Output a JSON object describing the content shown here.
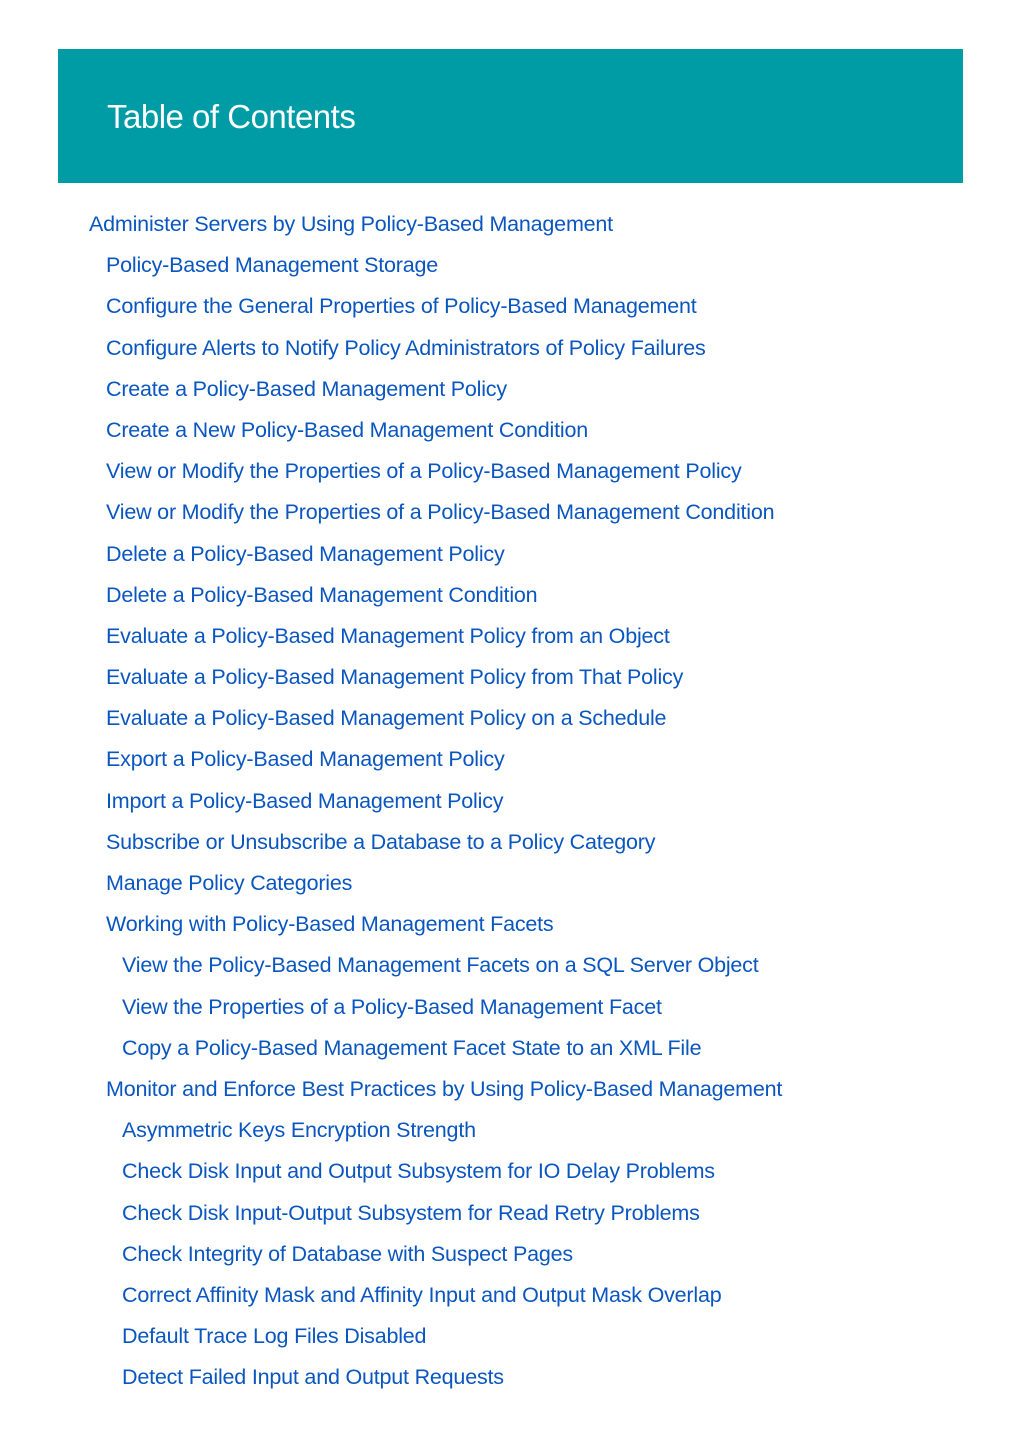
{
  "header": {
    "title": "Table of Contents",
    "background": "#009ca6"
  },
  "link_color": "#0a56c0",
  "toc": [
    {
      "level": 1,
      "label": "Administer Servers by Using Policy-Based Management"
    },
    {
      "level": 2,
      "label": "Policy-Based Management Storage"
    },
    {
      "level": 2,
      "label": "Configure the General Properties of Policy-Based Management"
    },
    {
      "level": 2,
      "label": "Configure Alerts to Notify Policy Administrators of Policy Failures"
    },
    {
      "level": 2,
      "label": "Create a Policy-Based Management Policy"
    },
    {
      "level": 2,
      "label": "Create a New Policy-Based Management Condition"
    },
    {
      "level": 2,
      "label": "View or Modify the Properties of a Policy-Based Management Policy"
    },
    {
      "level": 2,
      "label": "View or Modify the Properties of a Policy-Based Management Condition"
    },
    {
      "level": 2,
      "label": "Delete a Policy-Based Management Policy"
    },
    {
      "level": 2,
      "label": "Delete a Policy-Based Management Condition"
    },
    {
      "level": 2,
      "label": "Evaluate a Policy-Based Management Policy from an Object"
    },
    {
      "level": 2,
      "label": "Evaluate a Policy-Based Management Policy from That Policy"
    },
    {
      "level": 2,
      "label": "Evaluate a Policy-Based Management Policy on a Schedule"
    },
    {
      "level": 2,
      "label": "Export a Policy-Based Management Policy"
    },
    {
      "level": 2,
      "label": "Import a Policy-Based Management Policy"
    },
    {
      "level": 2,
      "label": "Subscribe or Unsubscribe a Database to a Policy Category"
    },
    {
      "level": 2,
      "label": "Manage Policy Categories"
    },
    {
      "level": 2,
      "label": "Working with Policy-Based Management Facets"
    },
    {
      "level": 3,
      "label": "View the Policy-Based Management Facets on a SQL Server Object"
    },
    {
      "level": 3,
      "label": "View the Properties of a Policy-Based Management Facet"
    },
    {
      "level": 3,
      "label": "Copy a Policy-Based Management Facet State to an XML File"
    },
    {
      "level": 2,
      "label": "Monitor and Enforce Best Practices by Using Policy-Based Management"
    },
    {
      "level": 3,
      "label": "Asymmetric Keys Encryption Strength"
    },
    {
      "level": 3,
      "label": "Check Disk Input and Output Subsystem for IO Delay Problems"
    },
    {
      "level": 3,
      "label": "Check Disk Input-Output Subsystem for Read Retry Problems"
    },
    {
      "level": 3,
      "label": "Check Integrity of Database with Suspect Pages"
    },
    {
      "level": 3,
      "label": "Correct Affinity Mask and Affinity Input and Output Mask Overlap"
    },
    {
      "level": 3,
      "label": "Default Trace Log Files Disabled"
    },
    {
      "level": 3,
      "label": "Detect Failed Input and Output Requests"
    }
  ]
}
